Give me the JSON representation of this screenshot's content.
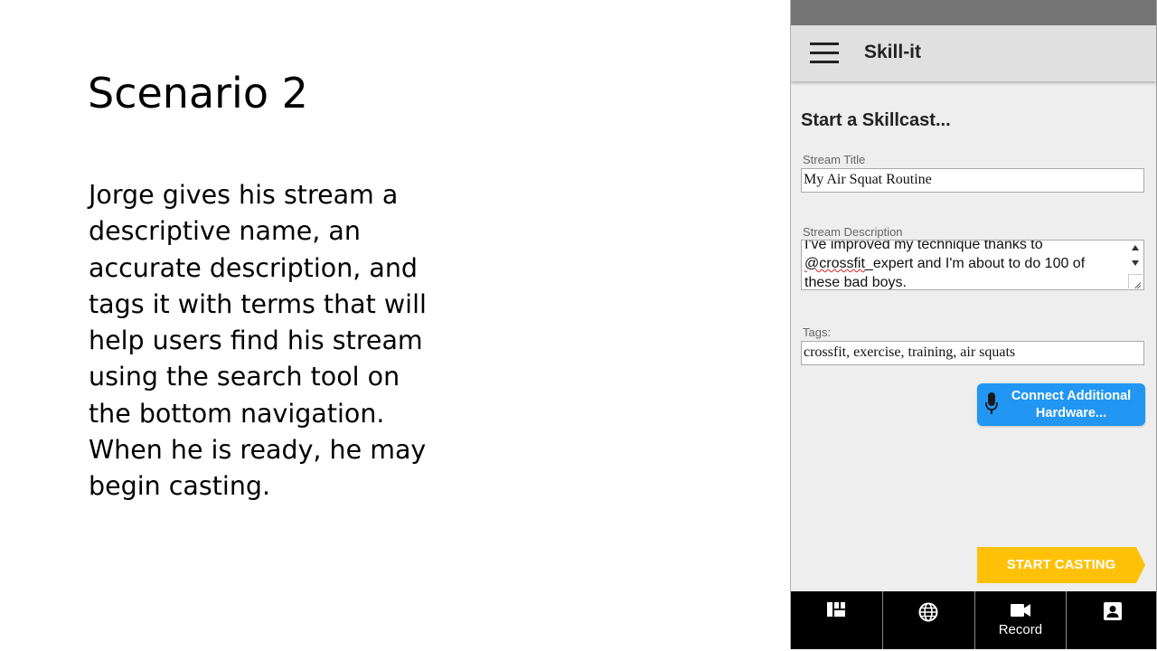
{
  "slide": {
    "title": "Scenario 2",
    "body": "Jorge gives his stream a descriptive name, an accurate description, and tags it with terms that will help users find his stream using the search tool on the bottom navigation. When he is ready, he may begin casting."
  },
  "app": {
    "title": "Skill-it",
    "heading": "Start a Skillcast...",
    "stream_title": {
      "label": "Stream Title",
      "value": "My Air Squat Routine"
    },
    "stream_description": {
      "label": "Stream Description",
      "line1": "I've improved my technique thanks to",
      "line2_mention": "@crossfit",
      "line2_rest": "_expert and I'm about to do 100 of",
      "line3": "these bad boys."
    },
    "tags": {
      "label": "Tags:",
      "value": "crossfit, exercise, training, air squats"
    },
    "connect_hardware_label": "Connect Additional Hardware...",
    "start_casting_label": "START CASTING",
    "bottom_nav": [
      {
        "icon": "dashboard-icon",
        "label": ""
      },
      {
        "icon": "globe-icon",
        "label": ""
      },
      {
        "icon": "video-camera-icon",
        "label": "Record"
      },
      {
        "icon": "account-box-icon",
        "label": ""
      }
    ],
    "colors": {
      "status_bar": "#757575",
      "app_bar": "#e0e0e0",
      "primary_button": "#2196f3",
      "start_button": "#ffc107",
      "bottom_nav": "#000000"
    }
  }
}
